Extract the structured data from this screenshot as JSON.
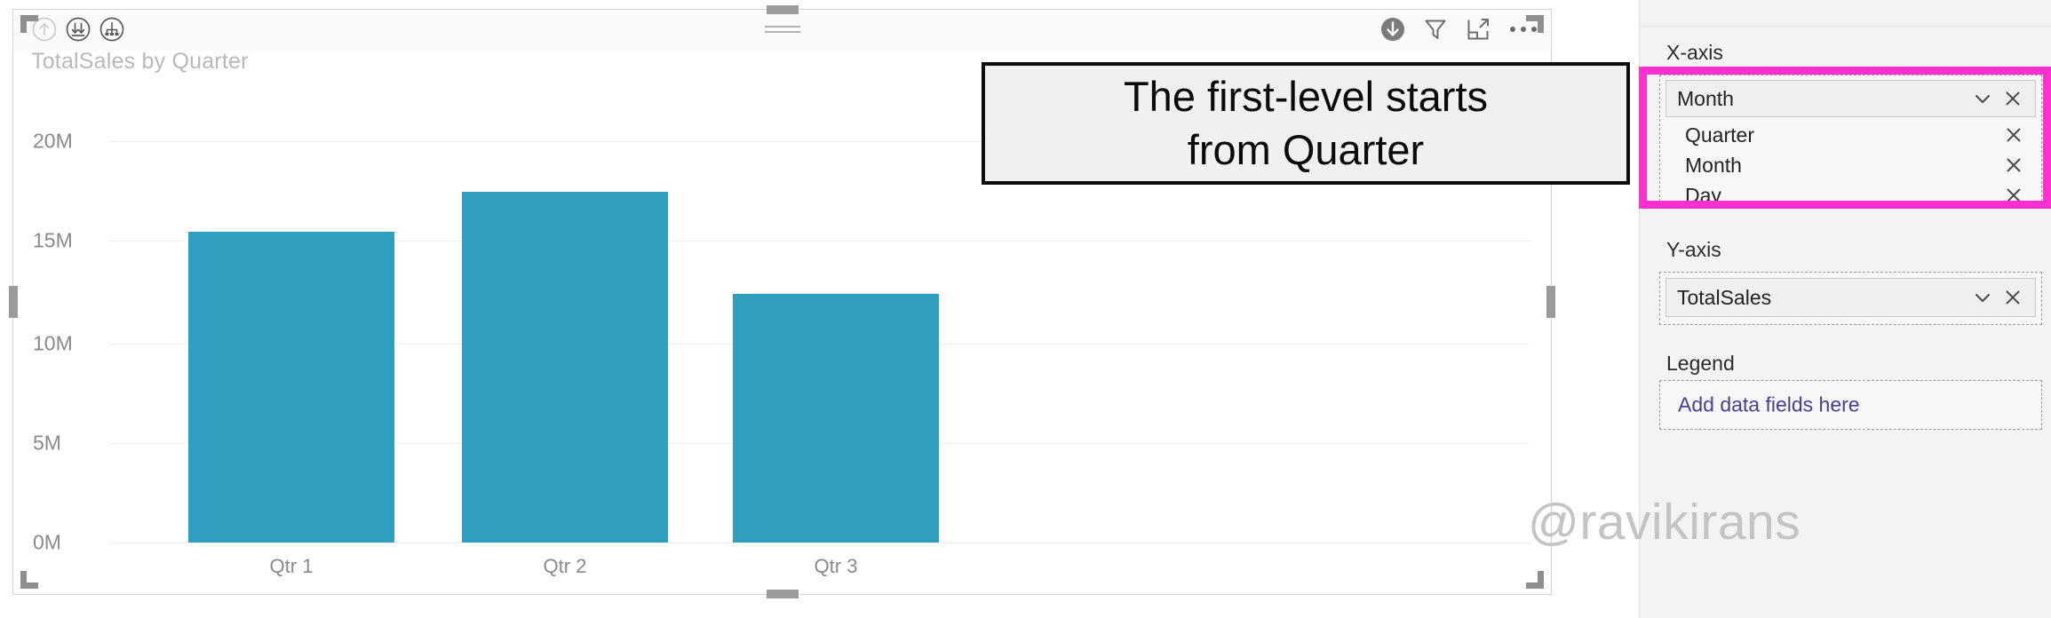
{
  "visual": {
    "title": "TotalSales by Quarter",
    "header_icons": [
      {
        "name": "drill-up-icon",
        "label": "Drill up"
      },
      {
        "name": "drill-down-toggle-icon",
        "label": "Drill down"
      },
      {
        "name": "expand-all-hierarchy-icon",
        "label": "Expand all down one level in the hierarchy"
      }
    ],
    "header_right_icons": [
      {
        "name": "drill-mode-active-icon",
        "label": "Drill mode"
      },
      {
        "name": "filter-funnel-icon",
        "label": "Filters"
      },
      {
        "name": "focus-mode-icon",
        "label": "Focus mode"
      },
      {
        "name": "more-options-icon",
        "label": "More options"
      }
    ]
  },
  "chart_data": {
    "type": "bar",
    "title": "TotalSales by Quarter",
    "categories": [
      "Qtr 1",
      "Qtr 2",
      "Qtr 3"
    ],
    "values": [
      15500000,
      17500000,
      12400000
    ],
    "value_labels": [
      "15.5M",
      "17.5M",
      "12.4M"
    ],
    "series": [
      {
        "name": "TotalSales",
        "values": [
          15500000,
          17500000,
          12400000
        ],
        "color": "#2e9fbe"
      }
    ],
    "xlabel": "",
    "ylabel": "",
    "ylim": [
      0,
      20000000
    ],
    "ytick_labels": [
      "20M",
      "15M",
      "10M",
      "5M",
      "0M"
    ],
    "ytick_values": [
      20000000,
      15000000,
      10000000,
      5000000,
      0
    ],
    "grid": true,
    "legend": "none",
    "bar_color": "#2e9fbe"
  },
  "callout": {
    "line1": "The first-level starts",
    "line2": "from Quarter"
  },
  "panel": {
    "x_axis": {
      "label": "X-axis",
      "field": "Month",
      "sub_fields": [
        "Quarter",
        "Month",
        "Day"
      ]
    },
    "y_axis": {
      "label": "Y-axis",
      "field": "TotalSales"
    },
    "legend": {
      "label": "Legend",
      "placeholder": "Add data fields here"
    },
    "highlight_color": "#ff2fd0"
  },
  "watermark": "@ravikirans"
}
